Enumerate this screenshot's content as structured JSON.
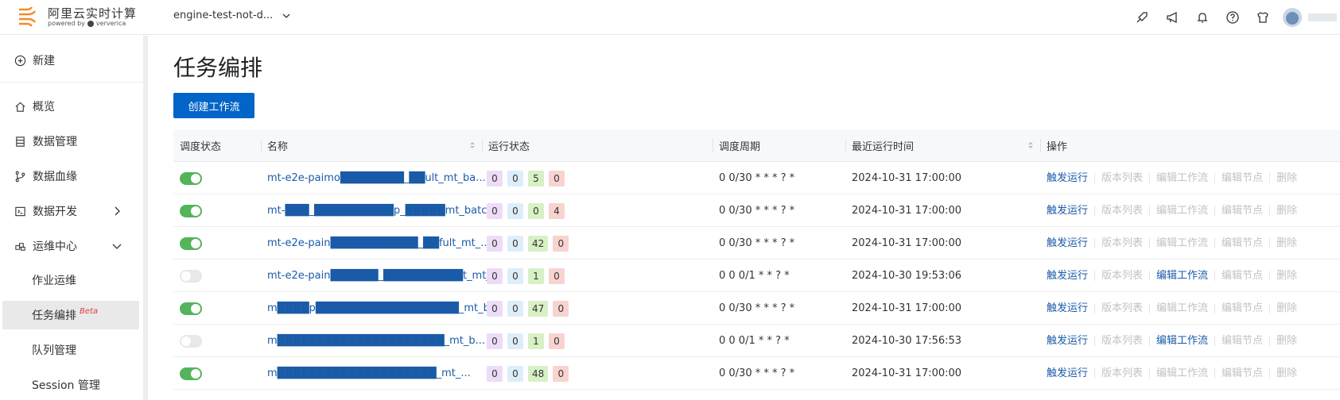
{
  "app": {
    "brand": "阿里云实时计算",
    "powered_by": "powered by",
    "powered_brand": "ververica",
    "workspace": "engine-test-not-d..."
  },
  "sidebar": {
    "new_label": "新建",
    "items": [
      {
        "label": "概览",
        "icon": "home-icon"
      },
      {
        "label": "数据管理",
        "icon": "database-icon"
      },
      {
        "label": "数据血缘",
        "icon": "lineage-icon"
      },
      {
        "label": "数据开发",
        "icon": "terminal-icon"
      },
      {
        "label": "运维中心",
        "icon": "ops-icon"
      }
    ],
    "sub_items": [
      {
        "label": "作业运维"
      },
      {
        "label": "任务编排",
        "badge": "Beta"
      },
      {
        "label": "队列管理"
      },
      {
        "label": "Session 管理"
      }
    ]
  },
  "main": {
    "title": "任务编排",
    "create_button": "创建工作流"
  },
  "table": {
    "columns": [
      "调度状态",
      "名称",
      "运行状态",
      "调度周期",
      "最近运行时间",
      "操作"
    ],
    "rows": [
      {
        "enabled": true,
        "name": "mt-e2e-paimo████████_██ult_mt_ba...",
        "counts": [
          "0",
          "0",
          "5",
          "0"
        ],
        "cron": "0 0/30 * * * ? *",
        "last_run": "2024-10-31 17:00:00",
        "edit_enabled": false
      },
      {
        "enabled": true,
        "name": "mt-███_██████████p_█████mt_batc...",
        "counts": [
          "0",
          "0",
          "0",
          "4"
        ],
        "cron": "0 0/30 * * * ? *",
        "last_run": "2024-10-31 17:00:00",
        "edit_enabled": false
      },
      {
        "enabled": true,
        "name": "mt-e2e-pain███████████_██fult_mt_...",
        "counts": [
          "0",
          "0",
          "42",
          "0"
        ],
        "cron": "0 0/30 * * * ? *",
        "last_run": "2024-10-31 17:00:00",
        "edit_enabled": false
      },
      {
        "enabled": false,
        "name": "mt-e2e-pain██████_██████████t_mt_...",
        "counts": [
          "0",
          "0",
          "1",
          "0"
        ],
        "cron": "0 0 0/1 * * ? *",
        "last_run": "2024-10-30 19:53:06",
        "edit_enabled": true
      },
      {
        "enabled": true,
        "name": "m████p██████████████████_mt_b...",
        "counts": [
          "0",
          "0",
          "47",
          "0"
        ],
        "cron": "0 0/30 * * * ? *",
        "last_run": "2024-10-31 17:00:00",
        "edit_enabled": false
      },
      {
        "enabled": false,
        "name": "m█████████████████████_mt_b...",
        "counts": [
          "0",
          "0",
          "1",
          "0"
        ],
        "cron": "0 0 0/1 * * ? *",
        "last_run": "2024-10-30 17:56:53",
        "edit_enabled": true
      },
      {
        "enabled": true,
        "name": "m████████████████████_mt_...",
        "counts": [
          "0",
          "0",
          "48",
          "0"
        ],
        "cron": "0 0/30 * * * ? *",
        "last_run": "2024-10-31 17:00:00",
        "edit_enabled": false
      }
    ],
    "ops": {
      "trigger": "触发运行",
      "versions": "版本列表",
      "edit_workflow": "编辑工作流",
      "edit_node": "编辑节点",
      "delete": "删除"
    }
  },
  "colors": {
    "primary": "#0064c8",
    "link": "#1a5ba8",
    "toggle_on": "#53b45c",
    "toggle_off": "#e8e8e8",
    "badge_purple": "#eddcf7",
    "badge_blue": "#ddeefa",
    "badge_green": "#d8f0c5",
    "badge_red": "#f8d3d0"
  }
}
